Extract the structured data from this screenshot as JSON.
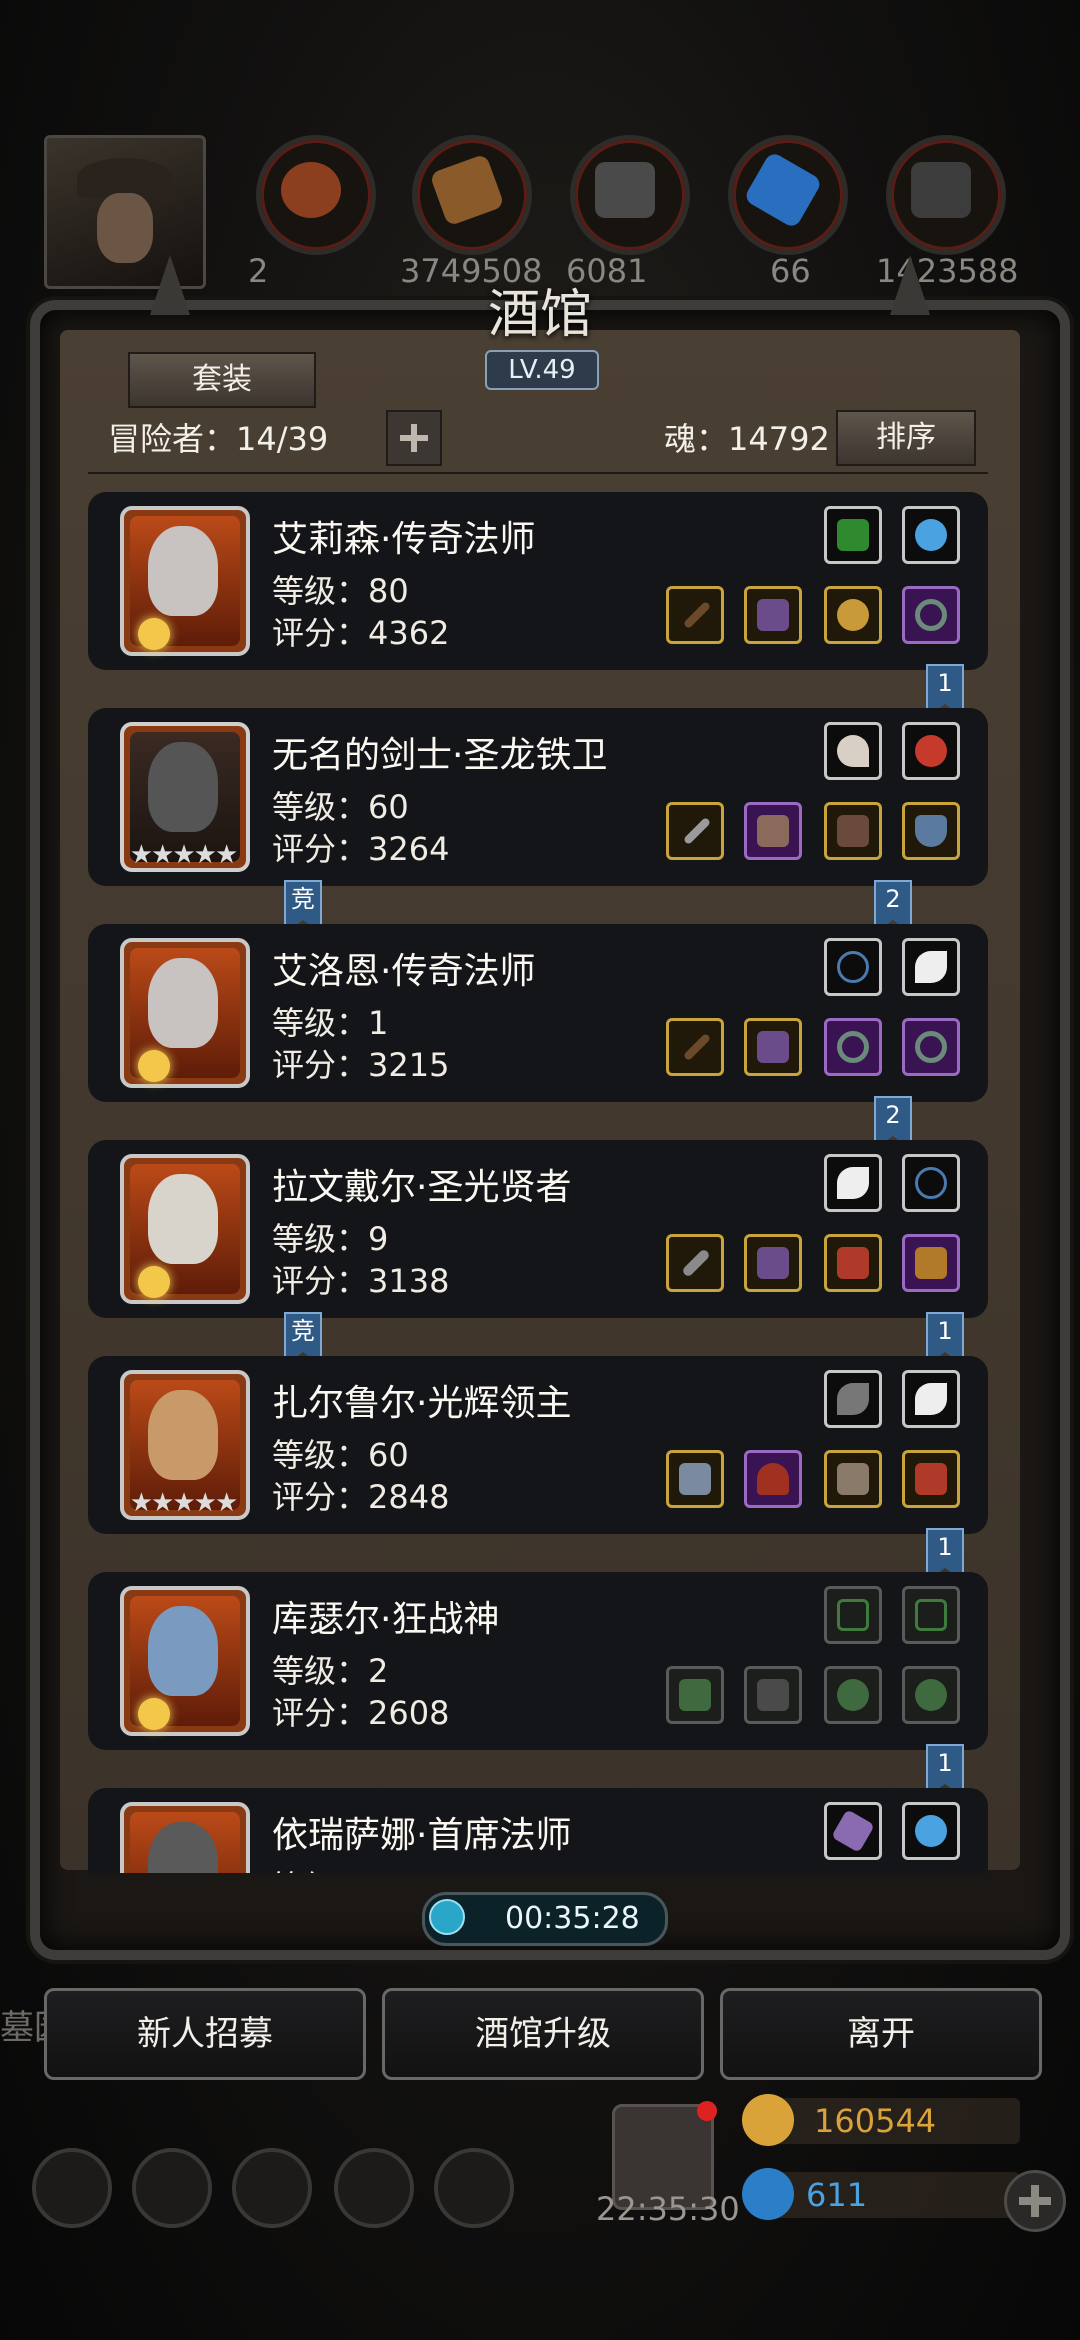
{
  "header": {
    "title": "酒馆",
    "level": "LV.49",
    "suit_button": "套装",
    "adventurers_label": "冒险者：14/39",
    "soul_label": "魂：14792",
    "sort_button": "排序"
  },
  "resources": [
    "2",
    "3749508",
    "6081",
    "66",
    "1423588"
  ],
  "heroes": [
    {
      "name": "艾莉森·传奇法师",
      "level": "等级：80",
      "score": "评分：4362",
      "rank": "moon"
    },
    {
      "name": "无名的剑士·圣龙铁卫",
      "level": "等级：60",
      "score": "评分：3264",
      "rank": "stars",
      "stars": "★★★★★"
    },
    {
      "name": "艾洛恩·传奇法师",
      "level": "等级：1",
      "score": "评分：3215",
      "rank": "moon"
    },
    {
      "name": "拉文戴尔·圣光贤者",
      "level": "等级：9",
      "score": "评分：3138",
      "rank": "moon"
    },
    {
      "name": "扎尔鲁尔·光辉领主",
      "level": "等级：60",
      "score": "评分：2848",
      "rank": "stars",
      "stars": "★★★★★"
    },
    {
      "name": "库瑟尔·狂战神",
      "level": "等级：2",
      "score": "评分：2608",
      "rank": "moon"
    },
    {
      "name": "依瑞萨娜·首席法师",
      "level": "等级",
      "score": "",
      "rank": "moon"
    }
  ],
  "ribbons": {
    "r1": "1",
    "r2": "2",
    "r3": "2",
    "r4": "1",
    "r5": "1",
    "r6": "1",
    "comp1": "竞",
    "comp2": "竞"
  },
  "timer": "00:35:28",
  "buttons": {
    "recruit": "新人招募",
    "upgrade": "酒馆升级",
    "leave": "离开"
  },
  "side_text": "墓园",
  "bottom": {
    "gold": "160544",
    "gems": "611",
    "clock": "22:35:30"
  },
  "colors": {
    "portrait_frame": "#bb4a18",
    "ribbon": "#2f5a86",
    "gold_text": "#d9a33a",
    "gem_text": "#4aa3e0"
  }
}
